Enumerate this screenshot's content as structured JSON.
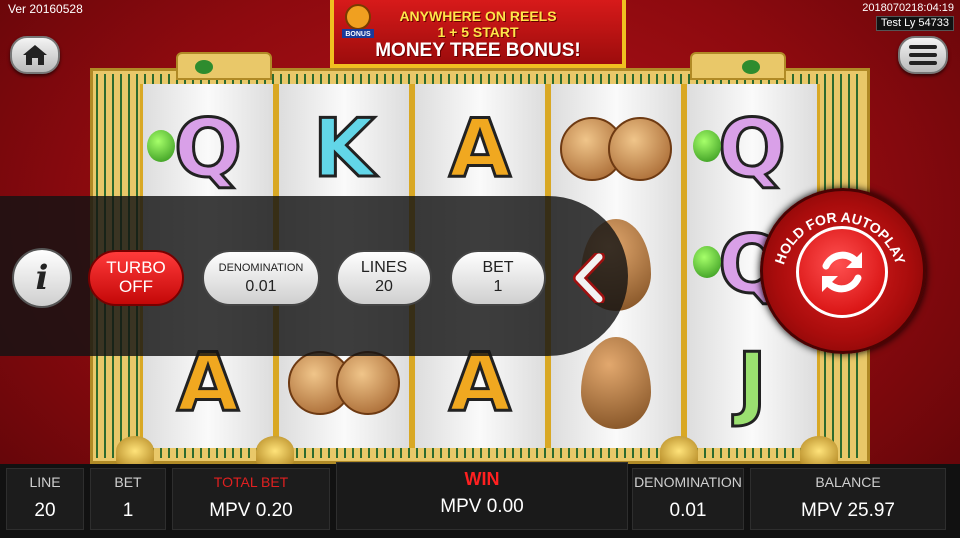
{
  "version": "Ver 20160528",
  "timestamp": "2018070218:04:19",
  "test_user": "Test Ly 54733",
  "banner": {
    "line1": "ANYWHERE ON REELS",
    "line2": "1 + 5 START",
    "line3": "MONEY TREE BONUS!",
    "icon_label": "BONUS"
  },
  "icons": {
    "home": "home-icon",
    "menu": "hamburger-menu-icon",
    "info": "info-icon",
    "chevron": "chevron-left-icon",
    "autoplay": "refresh-icon"
  },
  "controls": {
    "info_label": "i",
    "turbo": {
      "label": "TURBO",
      "value": "OFF"
    },
    "denomination": {
      "label": "DENOMINATION",
      "value": "0.01"
    },
    "lines": {
      "label": "LINES",
      "value": "20"
    },
    "bet": {
      "label": "BET",
      "value": "1"
    },
    "autoplay_label": "HOLD FOR AUTOPLAY"
  },
  "reels": [
    [
      "Q",
      "?",
      "A"
    ],
    [
      "K",
      "?",
      "coins"
    ],
    [
      "A",
      "?",
      "A"
    ],
    [
      "coins",
      "egg",
      "egg"
    ],
    [
      "Q",
      "Q",
      "J"
    ]
  ],
  "status_bar": {
    "line": {
      "label": "LINE",
      "value": "20"
    },
    "bet": {
      "label": "BET",
      "value": "1"
    },
    "total_bet": {
      "label": "TOTAL BET",
      "value": "MPV 0.20"
    },
    "win": {
      "label": "WIN",
      "value": "MPV 0.00"
    },
    "denomination": {
      "label": "DENOMINATION",
      "value": "0.01"
    },
    "balance": {
      "label": "BALANCE",
      "value": "MPV 25.97"
    }
  },
  "colors": {
    "background": "#a00e14",
    "accent_gold": "#f0c020",
    "turbo_red": "#e01010",
    "win_red": "#ff2020"
  }
}
